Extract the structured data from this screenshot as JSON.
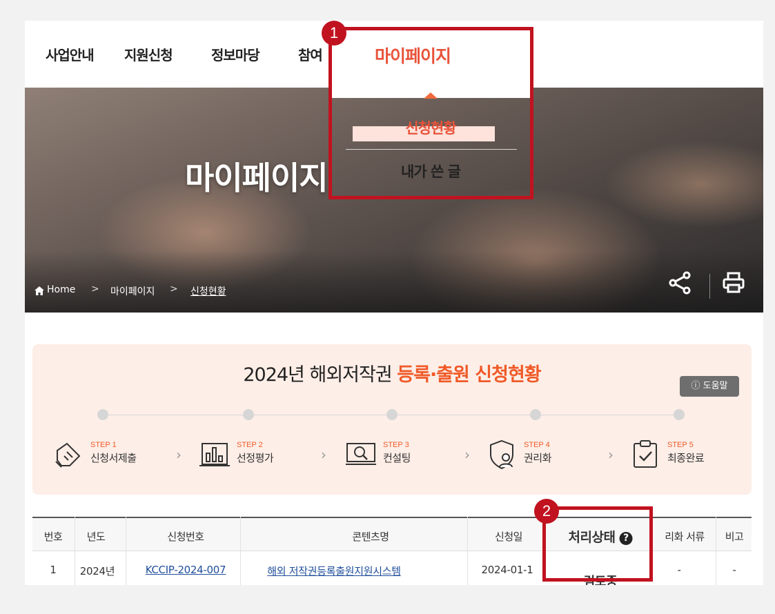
{
  "nav": {
    "items": [
      "사업안내",
      "지원신청",
      "정보마당",
      "참여",
      "마이페이지"
    ]
  },
  "hero": {
    "title": "마이페이지",
    "breadcrumb": [
      "Home",
      "마이페이지",
      "신청현황"
    ],
    "icons": [
      "share-icon",
      "print-icon"
    ]
  },
  "dropdown": {
    "header": "마이페이지",
    "items": [
      "신청현황",
      "내가 쓴 글"
    ]
  },
  "annotations": [
    "1",
    "2"
  ],
  "status_panel": {
    "title_prefix": "2024년 해외저작권 ",
    "title_emphasis": "등록·출원 신청현황",
    "help_label": "도움말",
    "steps": [
      {
        "num": "STEP 1",
        "label": "신청서제출",
        "icon": "document-pen-icon"
      },
      {
        "num": "STEP 2",
        "label": "선정평가",
        "icon": "bar-chart-icon"
      },
      {
        "num": "STEP 3",
        "label": "컨설팅",
        "icon": "monitor-search-icon"
      },
      {
        "num": "STEP 4",
        "label": "권리화",
        "icon": "shield-user-icon"
      },
      {
        "num": "STEP 5",
        "label": "최종완료",
        "icon": "clipboard-check-icon"
      }
    ]
  },
  "table": {
    "headers": [
      "번호",
      "년도",
      "신청번호",
      "콘텐츠명",
      "신청일",
      "처리상태",
      "리화 서류",
      "비고"
    ],
    "rows": [
      {
        "no": "1",
        "year": "2024년",
        "app_no": "KCCIP-2024-007",
        "content": "해외 저작권등록출원지원시스템",
        "date": "2024-01-1",
        "status": "검토중",
        "docs": "-",
        "note": "-"
      }
    ]
  },
  "colors": {
    "accent": "#e8533a",
    "orange": "#f05a28",
    "annotation_red": "#c1121f",
    "panel_bg": "#fdeee7",
    "link": "#1f4e9c"
  }
}
